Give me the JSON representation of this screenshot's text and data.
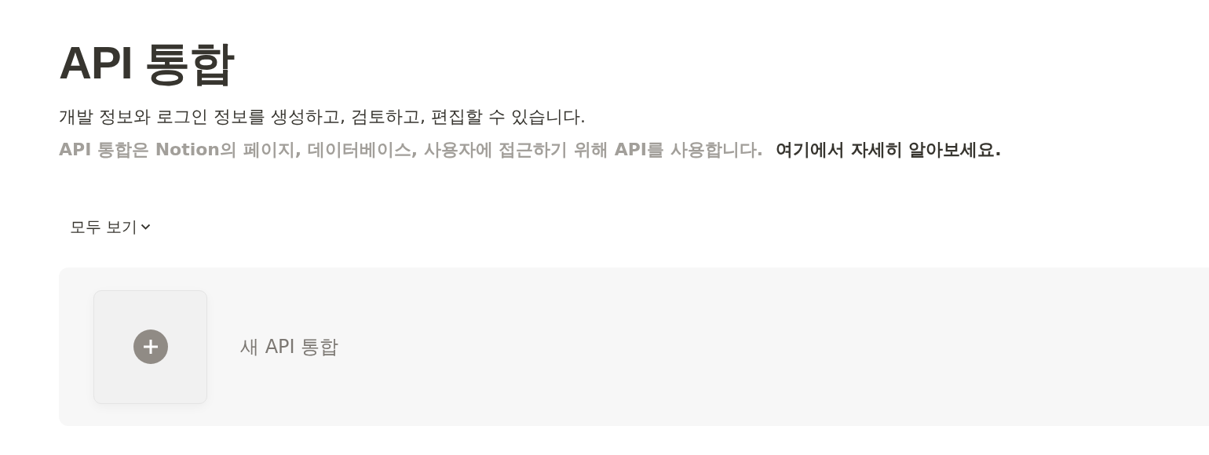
{
  "title": "API 통합",
  "subtitle": "개발 정보와 로그인 정보를 생성하고, 검토하고, 편집할 수 있습니다.",
  "description": "API 통합은 Notion의 페이지, 데이터베이스, 사용자에 접근하기 위해 API를 사용합니다.",
  "learn_more_link": "여기에서 자세히 알아보세요.",
  "filter": {
    "label": "모두 보기"
  },
  "new_integration": {
    "label": "새 API 통합"
  }
}
